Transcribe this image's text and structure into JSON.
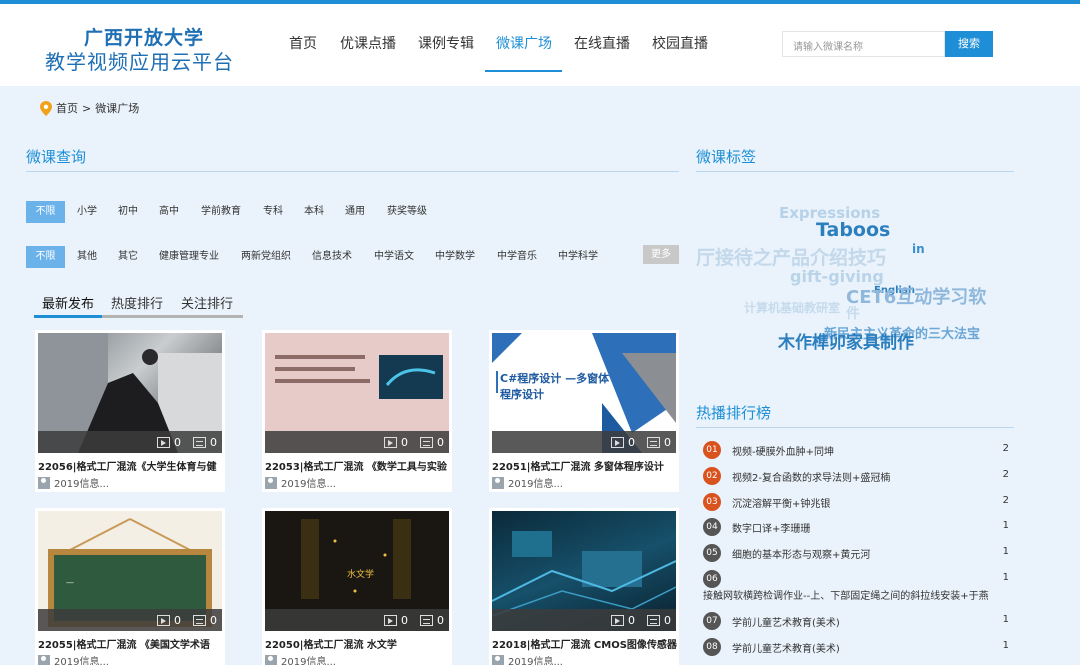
{
  "logo": {
    "line1": "广西开放大学",
    "line2": "教学视频应用云平台"
  },
  "nav": [
    "首页",
    "优课点播",
    "课例专辑",
    "微课广场",
    "在线直播",
    "校园直播"
  ],
  "search": {
    "placeholder": "请输入微课名称",
    "button": "搜索"
  },
  "breadcrumb": [
    "首页",
    ">",
    "微课广场"
  ],
  "query_title": "微课查询",
  "filters_row1": [
    "不限",
    "小学",
    "初中",
    "高中",
    "学前教育",
    "专科",
    "本科",
    "通用",
    "获奖等级"
  ],
  "filters_row2": [
    "不限",
    "其他",
    "其它",
    "健康管理专业",
    "两新党组织",
    "信息技术",
    "中学语文",
    "中学数学",
    "中学音乐",
    "中学科学"
  ],
  "more_label": "更多",
  "tabs": [
    "最新发布",
    "热度排行",
    "关注排行"
  ],
  "cards": [
    {
      "title": "22056|格式工厂混流《大学生体育与健",
      "sub": "2019信息...",
      "plays": "0",
      "comments": "0",
      "thumb_text": ""
    },
    {
      "title": "22053|格式工厂混流 《数学工具与实验",
      "sub": "2019信息...",
      "plays": "0",
      "comments": "0",
      "thumb_text": ""
    },
    {
      "title": "22051|格式工厂混流 多窗体程序设计",
      "sub": "2019信息...",
      "plays": "0",
      "comments": "0",
      "thumb_text": "C#程序设计 —多窗体程序设计"
    },
    {
      "title": "22055|格式工厂混流 《美国文学术语",
      "sub": "2019信息...",
      "plays": "0",
      "comments": "0",
      "thumb_text": ""
    },
    {
      "title": "22050|格式工厂混流 水文学",
      "sub": "2019信息...",
      "plays": "0",
      "comments": "0",
      "thumb_text": "水文学"
    },
    {
      "title": "22018|格式工厂混流 CMOS图像传感器",
      "sub": "2019信息...",
      "plays": "0",
      "comments": "0",
      "thumb_text": ""
    }
  ],
  "tag_title": "微课标签",
  "tag_cloud": [
    "Expressions",
    "Taboos",
    "厅接待之产品介绍技巧",
    "in",
    "gift-giving",
    "English",
    "CET6互动学习软",
    "计算机基础教研室",
    "件",
    "新民主主义革命的三大法宝",
    "木作榫卯家具制作"
  ],
  "rank_title": "热播排行榜",
  "rankings": [
    {
      "num": "01",
      "name": "视频-硬膜外血肿+同坤",
      "count": "2",
      "color": "#d9531e"
    },
    {
      "num": "02",
      "name": "视频2-复合函数的求导法则+盛冠楠",
      "count": "2",
      "color": "#d9531e"
    },
    {
      "num": "03",
      "name": "沉淀溶解平衡+钟兆银",
      "count": "2",
      "color": "#d9531e"
    },
    {
      "num": "04",
      "name": "数字口译+李珊珊",
      "count": "1",
      "color": "#555555"
    },
    {
      "num": "05",
      "name": "细胞的基本形态与观察+黄元河",
      "count": "1",
      "color": "#555555"
    },
    {
      "num": "06",
      "name": "接触网软横跨检调作业--上、下部固定绳之间的斜拉线安装+于燕",
      "count": "1",
      "color": "#555555"
    },
    {
      "num": "07",
      "name": "学前儿童艺术教育(美术)",
      "count": "1",
      "color": "#555555"
    },
    {
      "num": "08",
      "name": "学前儿童艺术教育(美术)",
      "count": "1",
      "color": "#555555"
    }
  ]
}
